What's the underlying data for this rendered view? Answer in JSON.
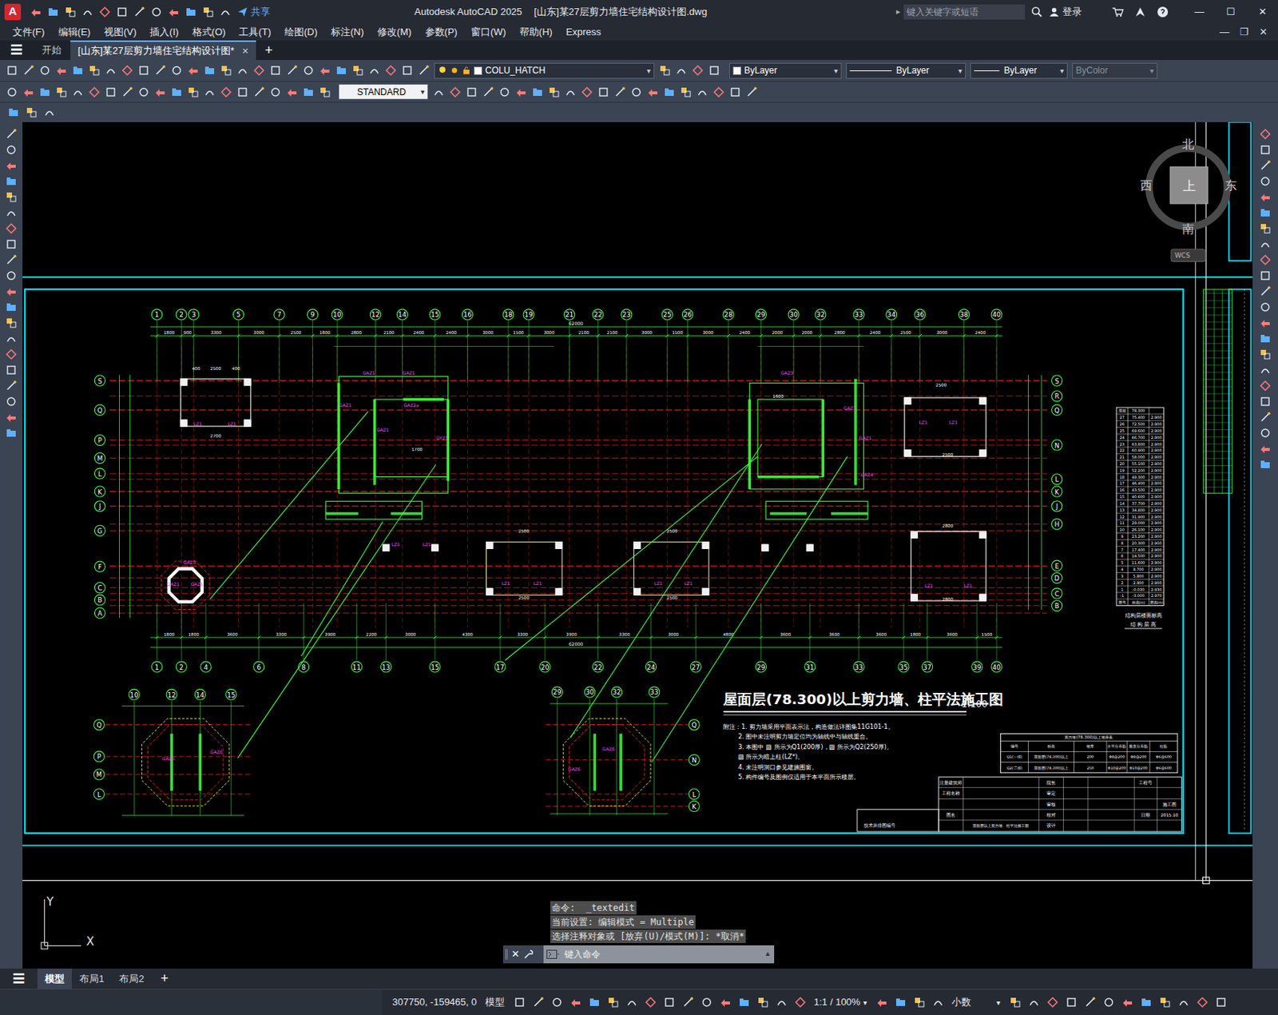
{
  "window": {
    "logo": "A",
    "app": "Autodesk AutoCAD 2025",
    "file": "[山东]某27层剪力墙住宅结构设计图.dwg",
    "share": "共享",
    "search_placeholder": "键入关键字或短语",
    "login": "登录",
    "controls": [
      "—",
      "☐",
      "✕"
    ]
  },
  "menu": [
    "文件(F)",
    "编辑(E)",
    "视图(V)",
    "插入(I)",
    "格式(O)",
    "工具(T)",
    "绘图(D)",
    "标注(N)",
    "修改(M)",
    "参数(P)",
    "窗口(W)",
    "帮助(H)",
    "Express"
  ],
  "doc_controls": [
    "—",
    "❐",
    "✕"
  ],
  "tab_bar": {
    "menu": "☰",
    "tabs": [
      {
        "label": "开始",
        "selected": false
      },
      {
        "label": "[山东]某27层剪力墙住宅结构设计图*",
        "selected": true
      }
    ],
    "close": "✕",
    "add": "+"
  },
  "toolbar": {
    "layer": "COLU_HATCH",
    "color": "ByLayer",
    "linetype": "ByLayer",
    "lineweight": "ByLayer",
    "plotstyle": "ByColor",
    "textstyle": "STANDARD"
  },
  "viewcube": {
    "north": "北",
    "south": "南",
    "west": "西",
    "east": "东",
    "face": "上",
    "wcs": "WCS"
  },
  "drawing": {
    "top_axes": [
      "1",
      "2",
      "3",
      "5",
      "7",
      "9",
      "10",
      "12",
      "14",
      "15",
      "16",
      "18",
      "19",
      "21",
      "22",
      "23",
      "25",
      "26",
      "28",
      "29",
      "30",
      "32",
      "33",
      "34",
      "36",
      "38",
      "40"
    ],
    "top_dims": [
      "1800",
      "900",
      "3300",
      "3000",
      "2500",
      "1800",
      "2800",
      "2100",
      "2400",
      "2400",
      "3000",
      "1500",
      "3000",
      "2100",
      "2100",
      "3000",
      "1500",
      "3000",
      "2400",
      "2000",
      "2000",
      "2800",
      "2400",
      "2500",
      "3000",
      "2400"
    ],
    "overall_top": "62000",
    "bottom_axes": [
      "1",
      "2",
      "4",
      "6",
      "8",
      "11",
      "13",
      "15",
      "17",
      "20",
      "22",
      "24",
      "27",
      "29",
      "31",
      "33",
      "35",
      "37",
      "39",
      "40"
    ],
    "bottom_dims": [
      "1800",
      "1800",
      "3600",
      "3300",
      "3900",
      "2200",
      "3000",
      "4300",
      "3300",
      "3900",
      "3300",
      "3000",
      "4800",
      "3600",
      "3600",
      "3600",
      "1800",
      "3600",
      "1500"
    ],
    "overall_bottom": "62000",
    "left_axes": [
      "S",
      "Q",
      "P",
      "M",
      "L",
      "K",
      "J",
      "G",
      "F",
      "C",
      "B",
      "A"
    ],
    "right_axes": [
      "S",
      "R",
      "Q",
      "N",
      "L",
      "K",
      "J",
      "H",
      "E",
      "D",
      "C",
      "B"
    ],
    "detail1_top": [
      "10",
      "12",
      "14",
      "15"
    ],
    "detail1_left": [
      "Q",
      "P",
      "M",
      "L"
    ],
    "detail2_top": [
      "29",
      "30",
      "32",
      "33"
    ],
    "detail2_right": [
      "Q",
      "N",
      "L",
      "K"
    ],
    "labels": [
      "GAZ1",
      "GAZ1",
      "GAZ1",
      "GAZ2a",
      "GAZ1",
      "GYZ1",
      "GAZ3",
      "GAZ1",
      "GAZ1",
      "GAZ4",
      "LZ1",
      "LZ1",
      "LZ1",
      "LZ1",
      "LZ1",
      "LZ1",
      "LZ1",
      "LZ1",
      "LZ1",
      "LZ1",
      "LZ1",
      "LZ1",
      "GAZ1",
      "GAZ1",
      "GAZ3",
      "GAZ6",
      "GAZ6",
      "GAZ6",
      "GAZ6"
    ],
    "room_dims": [
      "2500",
      "2700",
      "1700",
      "1600",
      "2500",
      "2500",
      "2800",
      "2800",
      "2500",
      "2500",
      "2500",
      "2500",
      "400",
      "400"
    ],
    "title": "屋面层(78.300)以上剪力墙、柱平法施工图",
    "scale": "1:100",
    "notes": [
      "附注：1. 剪力墙采用平面表示法，构造做法详图集11G101-1。",
      "2. 图中未注明剪力墙定位均为轴线中与轴线重合。",
      "3. 本图中 ▨ 所示为Q1(200厚)，▨ 所示为Q2(250厚)。",
      "▨ 所示为暗上柱(LZ*)。",
      "4. 未注明洞口参见建施图窗。",
      "5. 构件编号及图例仅适用于本平面所示楼层。"
    ],
    "wall_table": {
      "title": "剪力墙(78.300)以上墙身表",
      "rows": [
        [
          "编号",
          "标高",
          "墙厚",
          "水平分布筋",
          "垂直分布筋",
          "拉筋"
        ],
        [
          "Q1(一排)",
          "屋面层(78.300)以上",
          "200",
          "Φ8@200",
          "Φ8@200",
          "Φ6@600"
        ],
        [
          "Q2(二排)",
          "屋面层(78.300)以上",
          "250",
          "Φ10@200",
          "Φ10@200",
          "Φ6@600"
        ]
      ]
    },
    "title_block": [
      "注册建筑师",
      "工程名称",
      "屋面层以上剪力墙、柱平法施工图",
      "院长",
      "审定",
      "审核",
      "校对",
      "设计",
      "工程号",
      "日期",
      "2015.10",
      "技术并排图编号",
      "图名",
      "施工图"
    ],
    "level_table": {
      "header": [
        "层号",
        "标高(m)",
        "层高(m)"
      ],
      "rows": [
        [
          "屋面",
          "78.300",
          ""
        ],
        [
          "27",
          "75.400",
          "2.900"
        ],
        [
          "26",
          "72.500",
          "2.900"
        ],
        [
          "25",
          "69.600",
          "2.900"
        ],
        [
          "24",
          "66.700",
          "2.900"
        ],
        [
          "23",
          "63.800",
          "2.900"
        ],
        [
          "22",
          "60.900",
          "2.900"
        ],
        [
          "21",
          "58.000",
          "2.900"
        ],
        [
          "20",
          "55.100",
          "2.900"
        ],
        [
          "19",
          "52.200",
          "2.900"
        ],
        [
          "18",
          "49.300",
          "2.900"
        ],
        [
          "17",
          "46.400",
          "2.900"
        ],
        [
          "16",
          "43.500",
          "2.900"
        ],
        [
          "15",
          "40.600",
          "2.900"
        ],
        [
          "14",
          "37.700",
          "2.900"
        ],
        [
          "13",
          "34.800",
          "2.900"
        ],
        [
          "12",
          "31.900",
          "2.900"
        ],
        [
          "11",
          "29.000",
          "2.900"
        ],
        [
          "10",
          "26.100",
          "2.900"
        ],
        [
          "9",
          "23.200",
          "2.900"
        ],
        [
          "8",
          "20.300",
          "2.900"
        ],
        [
          "7",
          "17.400",
          "2.900"
        ],
        [
          "6",
          "14.500",
          "2.900"
        ],
        [
          "5",
          "11.600",
          "2.900"
        ],
        [
          "4",
          "8.700",
          "2.900"
        ],
        [
          "3",
          "5.800",
          "2.900"
        ],
        [
          "2",
          "2.900",
          "2.900"
        ],
        [
          "1",
          "-0.030",
          "2.930"
        ],
        [
          "-1",
          "-3.000",
          "2.970"
        ]
      ],
      "caption": [
        "结构层楼面标高",
        "结 构 层 高"
      ]
    }
  },
  "ucs": {
    "y": "Y",
    "x": "X"
  },
  "command": {
    "history": [
      "命令:  _textedit",
      "当前设置: 编辑模式 = Multiple",
      "选择注释对象或 [放弃(U)/模式(M)]: *取消*"
    ],
    "close": "✕",
    "placeholder": "键入命令"
  },
  "layouts": {
    "menu": "☰",
    "tabs": [
      {
        "label": "模型",
        "selected": true
      },
      {
        "label": "布局1",
        "selected": false
      },
      {
        "label": "布局2",
        "selected": false
      }
    ],
    "add": "+"
  },
  "status": {
    "coords": "307750, -159465, 0",
    "space": "模型",
    "scale": "1:1 / 100%",
    "units": "小数"
  }
}
